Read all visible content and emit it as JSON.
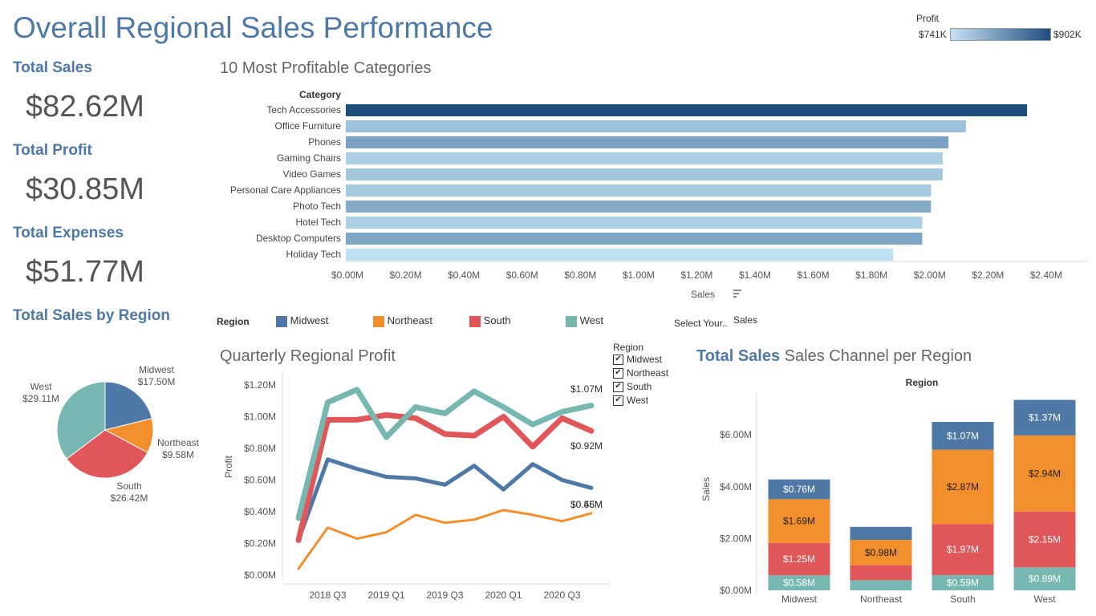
{
  "page": {
    "title": "Overall Regional Sales Performance"
  },
  "colors": {
    "midwest": "#4e79a7",
    "northeast": "#f28e2b",
    "south": "#e15759",
    "west": "#76b7b2",
    "title": "#4e79a7"
  },
  "profit_legend": {
    "label": "Profit",
    "min": "$741K",
    "max": "$902K"
  },
  "kpis": [
    {
      "label": "Total Sales",
      "value": "$82.62M"
    },
    {
      "label": "Total Profit",
      "value": "$30.85M"
    },
    {
      "label": "Total Expenses",
      "value": "$51.77M"
    }
  ],
  "region_legend": {
    "label": "Region",
    "items": [
      "Midwest",
      "Northeast",
      "South",
      "West"
    ],
    "select_label": "Select Your..",
    "select_value": "Sales"
  },
  "region_filter": {
    "label": "Region",
    "items": [
      "Midwest",
      "Northeast",
      "South",
      "West"
    ]
  },
  "sections": {
    "top_categories": "10 Most Profitable Categories",
    "sales_by_region": "Total Sales by Region",
    "quarterly_profit": "Quarterly Regional Profit",
    "channel_bold": "Total Sales",
    "channel_rest": " Sales Channel per Region"
  },
  "chart_data": [
    {
      "type": "bar",
      "orientation": "horizontal",
      "title": "10 Most Profitable Categories",
      "ylabel": "Category",
      "xlabel": "Sales",
      "categories": [
        "Tech Accessories",
        "Office Furniture",
        "Phones",
        "Gaming Chairs",
        "Video Games",
        "Personal Care Appliances",
        "Photo Tech",
        "Hotel Tech",
        "Desktop Computers",
        "Holiday Tech"
      ],
      "values": [
        2.34,
        2.13,
        2.07,
        2.05,
        2.05,
        2.01,
        2.01,
        1.98,
        1.98,
        1.88
      ],
      "profit_shade": [
        902,
        775,
        810,
        760,
        770,
        765,
        800,
        760,
        805,
        741
      ],
      "x_ticks": [
        "$0.00M",
        "$0.20M",
        "$0.40M",
        "$0.60M",
        "$0.80M",
        "$1.00M",
        "$1.20M",
        "$1.40M",
        "$1.60M",
        "$1.80M",
        "$2.00M",
        "$2.20M",
        "$2.40M"
      ],
      "xlim": [
        0,
        2.45
      ]
    },
    {
      "type": "pie",
      "title": "Total Sales by Region",
      "slices": [
        {
          "label": "Midwest",
          "value": 17.5,
          "display": "$17.50M"
        },
        {
          "label": "Northeast",
          "value": 9.58,
          "display": "$9.58M"
        },
        {
          "label": "South",
          "value": 26.42,
          "display": "$26.42M"
        },
        {
          "label": "West",
          "value": 29.11,
          "display": "$29.11M"
        }
      ]
    },
    {
      "type": "line",
      "title": "Quarterly Regional Profit",
      "ylabel": "Profit",
      "x": [
        "2018 Q2",
        "2018 Q3",
        "2018 Q4",
        "2019 Q1",
        "2019 Q2",
        "2019 Q3",
        "2019 Q4",
        "2020 Q1",
        "2020 Q2",
        "2020 Q3",
        "2020 Q4"
      ],
      "x_tick_labels": [
        "2018 Q3",
        "2019 Q1",
        "2019 Q3",
        "2020 Q1",
        "2020 Q3"
      ],
      "y_ticks": [
        "$0.00M",
        "$0.20M",
        "$0.40M",
        "$0.60M",
        "$0.80M",
        "$1.00M",
        "$1.20M"
      ],
      "ylim": [
        0,
        1.25
      ],
      "series": [
        {
          "name": "Midwest",
          "values": [
            0.22,
            0.73,
            0.67,
            0.62,
            0.61,
            0.57,
            0.69,
            0.54,
            0.7,
            0.6,
            0.55
          ],
          "end_label": "$0.55M"
        },
        {
          "name": "Northeast",
          "values": [
            0.04,
            0.3,
            0.23,
            0.27,
            0.38,
            0.33,
            0.35,
            0.41,
            0.38,
            0.34,
            0.39
          ],
          "end_label": "$0.46M"
        },
        {
          "name": "South",
          "values": [
            0.22,
            0.98,
            0.98,
            1.01,
            0.99,
            0.89,
            0.88,
            1.0,
            0.81,
            0.99,
            0.91
          ],
          "end_label": "$0.92M"
        },
        {
          "name": "West",
          "values": [
            0.36,
            1.09,
            1.17,
            0.87,
            1.06,
            1.02,
            1.16,
            1.06,
            0.95,
            1.03,
            1.07
          ],
          "end_label": "$1.07M"
        }
      ]
    },
    {
      "type": "bar",
      "stacked": true,
      "title": "Total Sales Sales Channel per Region",
      "xlabel": "Region",
      "ylabel": "Sales",
      "categories": [
        "Midwest",
        "Northeast",
        "South",
        "West"
      ],
      "y_ticks": [
        "$0.00M",
        "$2.00M",
        "$4.00M",
        "$6.00M"
      ],
      "ylim": [
        0,
        7.5
      ],
      "series": [
        {
          "name": "West",
          "values": [
            0.58,
            0.39,
            0.59,
            0.89
          ],
          "labels": [
            "$0.58M",
            "",
            "$0.59M",
            "$0.89M"
          ]
        },
        {
          "name": "South",
          "values": [
            1.25,
            0.58,
            1.97,
            2.15
          ],
          "labels": [
            "$1.25M",
            "",
            "$1.97M",
            "$2.15M"
          ]
        },
        {
          "name": "Northeast",
          "values": [
            1.69,
            0.98,
            2.87,
            2.94
          ],
          "labels": [
            "$1.69M",
            "$0.98M",
            "$2.87M",
            "$2.94M"
          ]
        },
        {
          "name": "Midwest",
          "values": [
            0.76,
            0.5,
            1.07,
            1.37
          ],
          "labels": [
            "$0.76M",
            "",
            "$1.07M",
            "$1.37M"
          ]
        }
      ]
    }
  ]
}
